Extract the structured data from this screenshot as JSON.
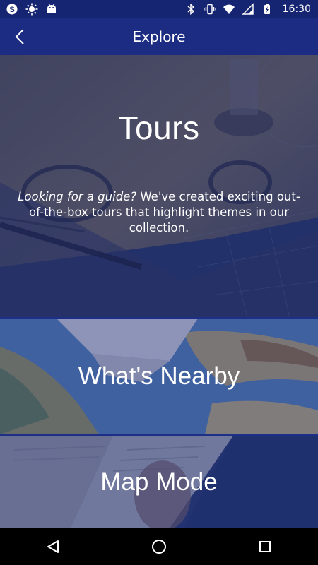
{
  "status_bar": {
    "time": "16:30",
    "left_icons": [
      "skype-icon",
      "settings-sun-icon",
      "android-icon"
    ],
    "right_icons": [
      "bluetooth-icon",
      "vibrate-icon",
      "wifi-icon",
      "cell-signal-icon",
      "battery-icon"
    ]
  },
  "app_bar": {
    "title": "Explore",
    "back_icon": "chevron-left-icon"
  },
  "panels": {
    "tours": {
      "title": "Tours",
      "desc_italic": "Looking for a guide?",
      "desc_rest": " We've created exciting out-of-the-box tours that highlight themes in our collection."
    },
    "nearby": {
      "title": "What's Nearby"
    },
    "map_mode": {
      "title": "Map Mode"
    }
  },
  "nav_bar": {
    "back": "back-triangle-icon",
    "home": "home-circle-icon",
    "recents": "recents-square-icon"
  },
  "colors": {
    "status_bar": "#162572",
    "app_bar": "#1c2c83",
    "overlay": "#1a2a7a"
  }
}
